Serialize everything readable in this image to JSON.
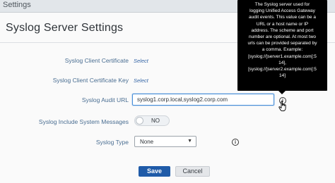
{
  "topbar": {
    "title": "Settings"
  },
  "page": {
    "title": "Syslog Server Settings"
  },
  "fields": {
    "client_certificate": {
      "label": "Syslog Client Certificate",
      "action": "Select"
    },
    "client_certificate_key": {
      "label": "Syslog Client Certificate Key",
      "action": "Select"
    },
    "audit_url": {
      "label": "Syslog Audit URL",
      "value": "syslog1.corp.local,syslog2.corp.com"
    },
    "include_system_messages": {
      "label": "Syslog Include System Messages",
      "toggle_text": "NO",
      "enabled": false
    },
    "type": {
      "label": "Syslog Type",
      "selected": "None"
    }
  },
  "tooltip": {
    "lines": [
      "The Syslog server used for",
      "logging Unified Access Gateway",
      "audit events. This value can be a",
      "URL or a host name or IP",
      "address. The scheme and port",
      "number are optional. At most two",
      "urls can be provided separated by",
      "a comma. Example:",
      "[syslog://]server1.example.com[:5",
      "14],",
      "[syslog://]server2.example.com[:5",
      "14]"
    ]
  },
  "buttons": {
    "save": "Save",
    "cancel": "Cancel"
  },
  "icons": {
    "info": "info-icon",
    "cursor": "hand-pointer-icon",
    "chevron": "chevron-down-icon"
  },
  "colors": {
    "primary": "#1f5ba8",
    "label": "#4a6e92",
    "focus": "#4a90d9"
  }
}
